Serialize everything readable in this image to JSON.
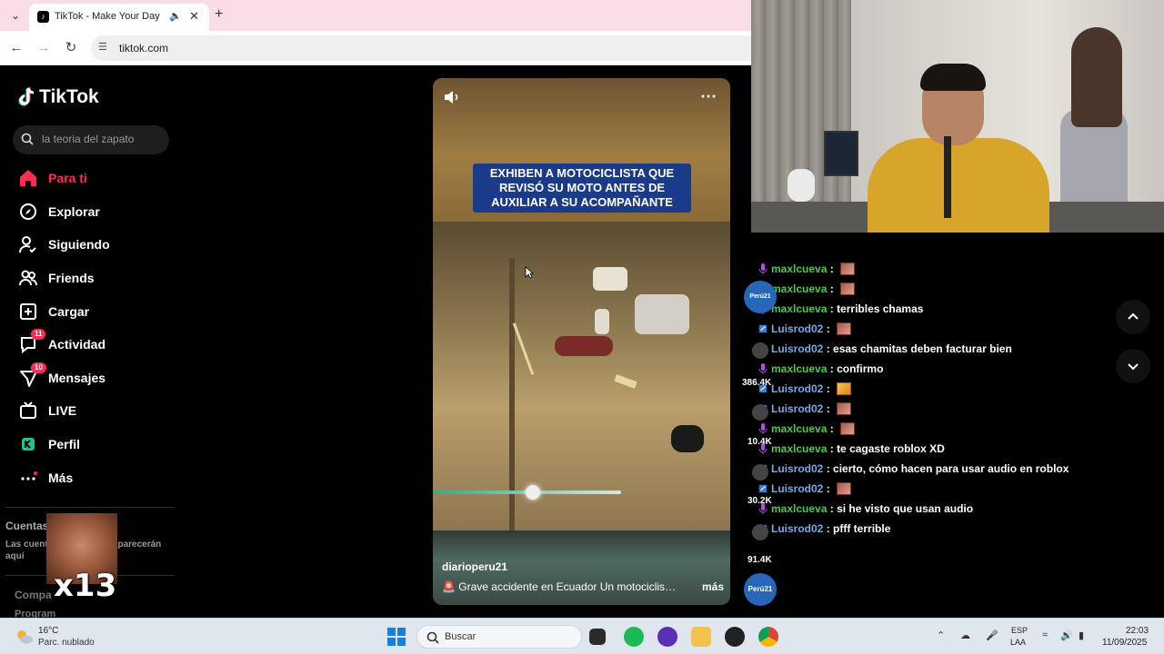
{
  "browser": {
    "tab_title": "TikTok - Make Your Day",
    "url": "tiktok.com"
  },
  "tiktok": {
    "logo": "TikTok",
    "search_placeholder": "la teoria del zapato",
    "nav": [
      {
        "label": "Para ti",
        "icon": "home-icon",
        "active": true
      },
      {
        "label": "Explorar",
        "icon": "compass-icon"
      },
      {
        "label": "Siguiendo",
        "icon": "following-icon"
      },
      {
        "label": "Friends",
        "icon": "friends-icon"
      },
      {
        "label": "Cargar",
        "icon": "upload-icon"
      },
      {
        "label": "Actividad",
        "icon": "activity-icon",
        "badge": "11"
      },
      {
        "label": "Mensajes",
        "icon": "messages-icon",
        "badge": "10"
      },
      {
        "label": "LIVE",
        "icon": "live-icon"
      },
      {
        "label": "Perfil",
        "icon": "profile-icon"
      },
      {
        "label": "Más",
        "icon": "more-icon"
      }
    ],
    "accounts_title": "Cuentas",
    "accounts_desc_a": "Las cuent",
    "accounts_desc_b": "parecerán",
    "accounts_desc_c": "aquí",
    "footer_1": "Compa",
    "footer_2": "Program",
    "sticker_text": "x13"
  },
  "video": {
    "headline": "EXHIBEN A MOTOCICLISTA QUE REVISÓ SU MOTO ANTES DE AUXILIAR A SU ACOMPAÑANTE",
    "author": "diarioperu21",
    "caption": "Grave accidente en Ecuador  Un motociclista ...",
    "more": "más",
    "progress": 0.53
  },
  "chat": {
    "messages": [
      {
        "user": "maxlcueva",
        "color": "green",
        "text": "",
        "emote": true
      },
      {
        "user": "maxlcueva",
        "color": "green",
        "text": "",
        "emote": true
      },
      {
        "user": "maxlcueva",
        "color": "green",
        "text": "terribles chamas"
      },
      {
        "user": "Luisrod02",
        "color": "blue",
        "text": "",
        "emote": true
      },
      {
        "user": "Luisrod02",
        "color": "blue",
        "text": "esas chamitas deben facturar bien"
      },
      {
        "user": "maxlcueva",
        "color": "green",
        "text": "confirmo"
      },
      {
        "user": "Luisrod02",
        "color": "blue",
        "text": "",
        "emote": true,
        "fire": true
      },
      {
        "user": "Luisrod02",
        "color": "blue",
        "text": "",
        "emote": true
      },
      {
        "user": "maxlcueva",
        "color": "green",
        "text": "",
        "emote": true
      },
      {
        "user": "maxlcueva",
        "color": "green",
        "text": "te cagaste roblox XD"
      },
      {
        "user": "Luisrod02",
        "color": "blue",
        "text": "cierto, cómo hacen para usar audio en roblox"
      },
      {
        "user": "Luisrod02",
        "color": "blue",
        "text": "",
        "emote": true
      },
      {
        "user": "maxlcueva",
        "color": "green",
        "text": "si he visto que usan audio"
      },
      {
        "user": "Luisrod02",
        "color": "blue",
        "text": "pfff terrible"
      }
    ]
  },
  "side": {
    "avatar_label": "Perú21",
    "stat_1": "386.4K",
    "stat_2": "10.4K",
    "stat_3": "30.2K",
    "stat_4": "91.4K"
  },
  "taskbar": {
    "temp": "16°C",
    "weather": "Parc. nublado",
    "search": "Buscar",
    "lang_1": "ESP",
    "lang_2": "LAA",
    "time": "22:03",
    "date": "11/09/2025"
  },
  "colors": {
    "accent": "#fe2c55",
    "chat_green": "#4fc84f",
    "chat_blue": "#7aa8e8"
  }
}
